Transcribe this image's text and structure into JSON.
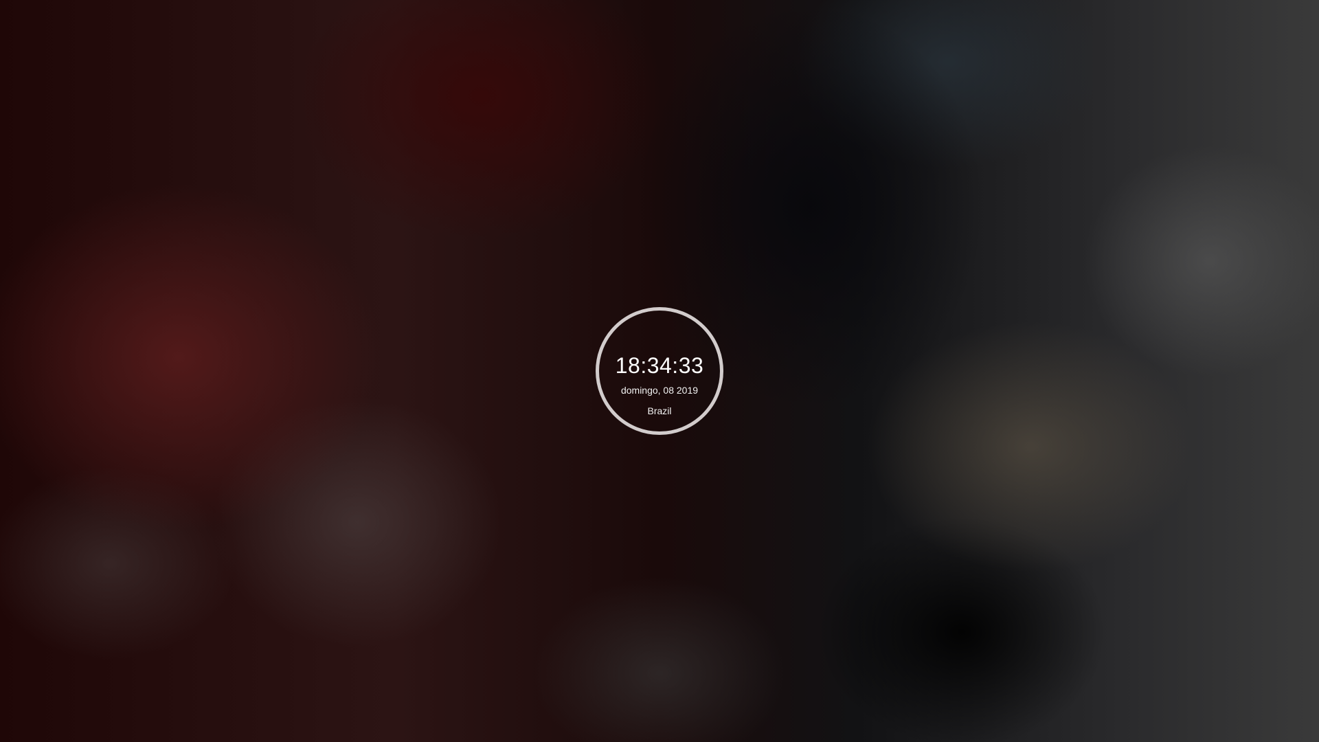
{
  "screen": {
    "type": "lock-screen",
    "wallpaper": "blurred-photo",
    "accent_ring_color": "#d2cccc"
  },
  "clock": {
    "time": "18:34:33",
    "date": "domingo, 08 2019",
    "location": "Brazil"
  }
}
